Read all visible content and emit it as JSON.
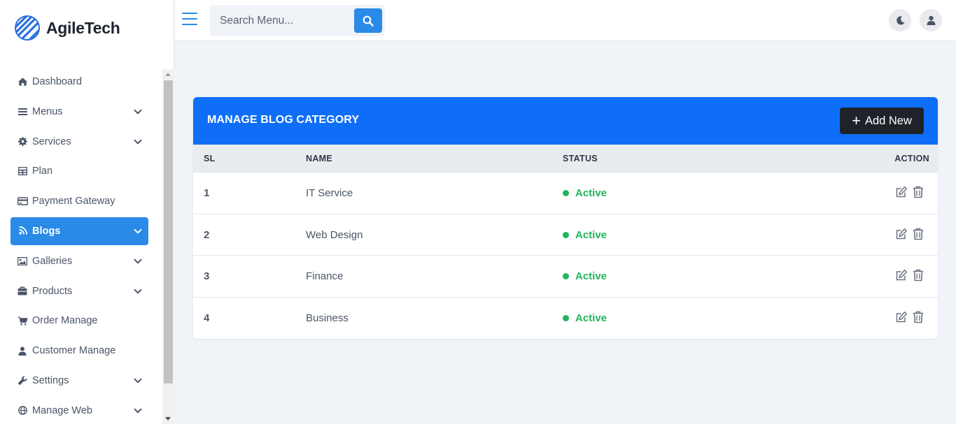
{
  "brand": {
    "name": "AgileTech"
  },
  "sidebar": {
    "items": [
      {
        "label": "Dashboard",
        "icon": "home-icon",
        "chevron": false,
        "active": false
      },
      {
        "label": "Menus",
        "icon": "bars-icon",
        "chevron": true,
        "active": false
      },
      {
        "label": "Services",
        "icon": "gear-icon",
        "chevron": true,
        "active": false
      },
      {
        "label": "Plan",
        "icon": "table-icon",
        "chevron": false,
        "active": false
      },
      {
        "label": "Payment Gateway",
        "icon": "credit-card-icon",
        "chevron": false,
        "active": false
      },
      {
        "label": "Blogs",
        "icon": "blog-icon",
        "chevron": true,
        "active": true
      },
      {
        "label": "Galleries",
        "icon": "image-icon",
        "chevron": true,
        "active": false
      },
      {
        "label": "Products",
        "icon": "briefcase-icon",
        "chevron": true,
        "active": false
      },
      {
        "label": "Order Manage",
        "icon": "cart-icon",
        "chevron": false,
        "active": false
      },
      {
        "label": "Customer Manage",
        "icon": "user-icon",
        "chevron": false,
        "active": false
      },
      {
        "label": "Settings",
        "icon": "wrench-icon",
        "chevron": true,
        "active": false
      },
      {
        "label": "Manage Web",
        "icon": "globe-icon",
        "chevron": true,
        "active": false
      }
    ]
  },
  "topbar": {
    "search_placeholder": "Search Menu...",
    "search_icon": "search-icon",
    "theme_icon": "moon-icon",
    "profile_icon": "user-icon"
  },
  "card": {
    "title": "MANAGE BLOG CATEGORY",
    "add_button": "Add New",
    "columns": {
      "sl": "SL",
      "name": "NAME",
      "status": "STATUS",
      "action": "ACTION"
    },
    "rows": [
      {
        "sl": "1",
        "name": "IT Service",
        "status": "Active"
      },
      {
        "sl": "2",
        "name": "Web Design",
        "status": "Active"
      },
      {
        "sl": "3",
        "name": "Finance",
        "status": "Active"
      },
      {
        "sl": "4",
        "name": "Business",
        "status": "Active"
      }
    ]
  },
  "colors": {
    "accent": "#2a8ae8",
    "header": "#0f6ef7",
    "status_active": "#22b55c",
    "dark_button": "#1f2229"
  }
}
